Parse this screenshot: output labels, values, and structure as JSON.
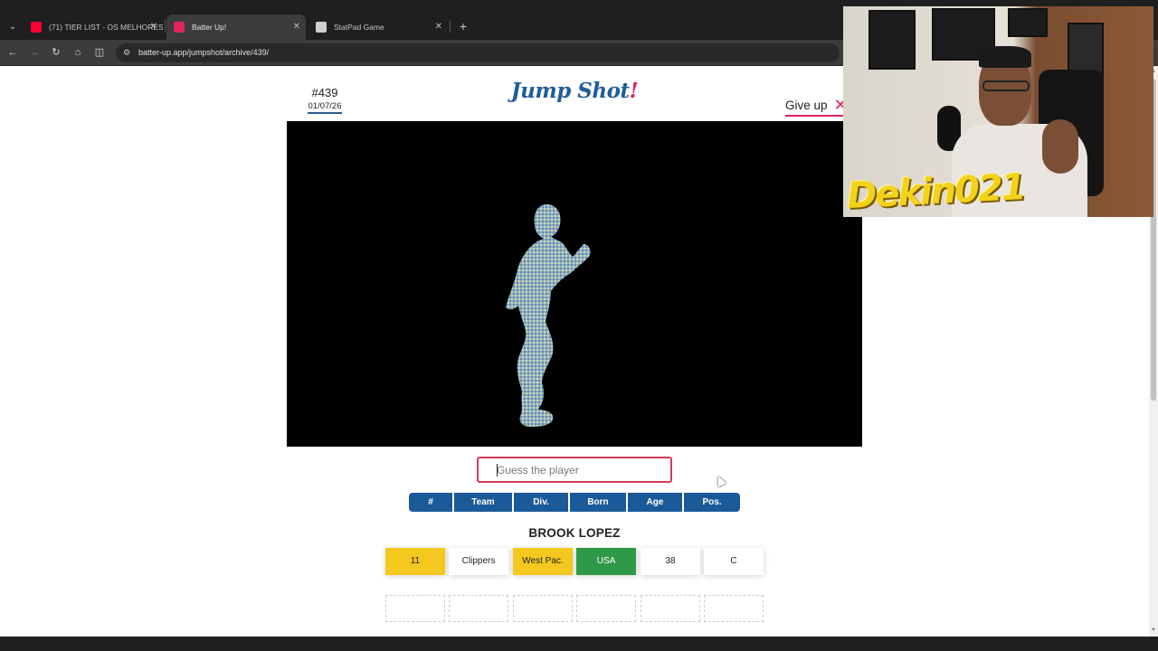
{
  "browser": {
    "tabs": [
      {
        "title": "(71) TIER LIST - OS MELHORES...",
        "favicon_color": "#ff0033",
        "active": false
      },
      {
        "title": "Batter Up!",
        "favicon_color": "#e0245e",
        "active": true
      },
      {
        "title": "StatPad Game",
        "favicon_color": "#cfcfcf",
        "active": false
      }
    ],
    "new_tab_label": "+",
    "url": "batter-up.app/jumpshot/archive/439/"
  },
  "game": {
    "puzzle_number": "#439",
    "puzzle_date": "01/07/26",
    "logo_text": "Jump Shot",
    "logo_bang": "!",
    "give_up_label": "Give up",
    "guess_placeholder": "Guess the player",
    "columns": [
      "#",
      "Team",
      "Div.",
      "Born",
      "Age",
      "Pos."
    ],
    "guesses": [
      {
        "name": "BROOK LOPEZ",
        "cells": [
          {
            "value": "11",
            "status": "close"
          },
          {
            "value": "Clippers",
            "status": "wrong"
          },
          {
            "value": "West Pac.",
            "status": "close"
          },
          {
            "value": "USA",
            "status": "correct"
          },
          {
            "value": "38",
            "status": "wrong"
          },
          {
            "value": "C",
            "status": "wrong"
          }
        ]
      }
    ],
    "empty_rows": 1
  },
  "webcam": {
    "streamer_name": "Dekin021"
  },
  "colors": {
    "accent_blue": "#1b5a99",
    "accent_pink": "#e0245e",
    "close_yellow": "#f4c81e",
    "correct_green": "#2e9a48"
  }
}
